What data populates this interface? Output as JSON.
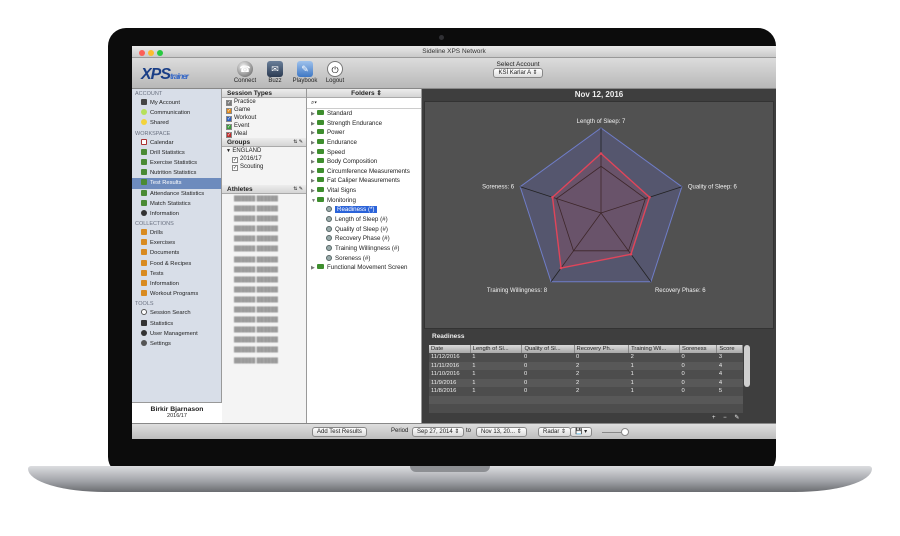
{
  "window": {
    "title": "Sideline XPS Network"
  },
  "logo": {
    "main": "XPS",
    "sub": "trainer"
  },
  "toolbar": [
    {
      "label": "Connect",
      "icon": "connect-icon"
    },
    {
      "label": "Buzz",
      "icon": "buzz-icon"
    },
    {
      "label": "Playbook",
      "icon": "playbook-icon"
    },
    {
      "label": "Logout",
      "icon": "logout-icon"
    }
  ],
  "account": {
    "label": "Select Account",
    "value": "KSÍ Karlar A"
  },
  "sidebar": {
    "account_header": "ACCOUNT",
    "account": [
      "My Account",
      "Communication",
      "Shared"
    ],
    "workspace_header": "WORKSPACE",
    "workspace": [
      "Calendar",
      "Drill Statistics",
      "Exercise Statistics",
      "Nutrition Statistics",
      "Test Results",
      "Attendance Statistics",
      "Match Statistics",
      "Information"
    ],
    "collections_header": "COLLECTIONS",
    "collections": [
      "Drills",
      "Exercises",
      "Documents",
      "Food & Recipes",
      "Tests",
      "Information",
      "Workout Programs"
    ],
    "tools_header": "TOOLS",
    "tools": [
      "Session Search",
      "Statistics",
      "User Management",
      "Settings"
    ]
  },
  "profile": {
    "name": "Birkir Bjarnason",
    "season": "2016/17"
  },
  "session_types": {
    "header": "Session Types",
    "items": [
      {
        "label": "Practice",
        "color": "#7a7a7a"
      },
      {
        "label": "Game",
        "color": "#e28a1b"
      },
      {
        "label": "Workout",
        "color": "#2c5fc0"
      },
      {
        "label": "Event",
        "color": "#3a9a3a"
      },
      {
        "label": "Meal",
        "color": "#c02b2b"
      }
    ]
  },
  "groups": {
    "header": "Groups",
    "items": [
      "ENGLAND",
      "2016/17",
      "Scouting"
    ]
  },
  "athletes": {
    "header": "Athletes"
  },
  "folders": {
    "label": "Folders",
    "search_placeholder": "",
    "items": [
      "Standard",
      "Strength Endurance",
      "Power",
      "Endurance",
      "Speed",
      "Body Composition",
      "Circumference Measurements",
      "Fat Caliper Measurements",
      "Vital Signs",
      "Monitoring"
    ],
    "monitoring": [
      "Readiness (*)",
      "Length of Sleep (#)",
      "Quality of Sleep (#)",
      "Recovery Phase (#)",
      "Training Willingness (#)",
      "Soreness (#)"
    ],
    "last": "Functional Movement Screen"
  },
  "chart_data": {
    "type": "radar",
    "title": "Nov 12, 2016",
    "axes": [
      "Length of Sleep: 7",
      "Quality of Sleep: 6",
      "Recovery Phase: 6",
      "Training Willingness: 8",
      "Soreness: 6"
    ],
    "values": [
      7,
      6,
      6,
      8,
      6
    ],
    "max": 10,
    "color": "#e0455a",
    "grid_color": "#222222"
  },
  "readiness": {
    "title": "Readiness",
    "columns": [
      "Date",
      "Length of Sl...",
      "Quality of Sl...",
      "Recovery Ph...",
      "Training Wil...",
      "Soreness",
      "Score"
    ],
    "rows": [
      [
        "11/12/2016",
        "1",
        "0",
        "0",
        "2",
        "0",
        "3"
      ],
      [
        "11/11/2016",
        "1",
        "0",
        "2",
        "1",
        "0",
        "4"
      ],
      [
        "11/10/2016",
        "1",
        "0",
        "2",
        "1",
        "0",
        "4"
      ],
      [
        "11/9/2016",
        "1",
        "0",
        "2",
        "1",
        "0",
        "4"
      ],
      [
        "11/8/2016",
        "1",
        "0",
        "2",
        "1",
        "0",
        "5"
      ],
      [
        "",
        "",
        "",
        "",
        "",
        "",
        ""
      ],
      [
        "",
        "",
        "",
        "",
        "",
        "",
        ""
      ]
    ]
  },
  "status": {
    "add_label": "Add Test Results",
    "period_label": "Period",
    "from": "Sep 27, 2014",
    "to_label": "to",
    "to": "Nov 13, 20...",
    "chart_type": "Radar"
  }
}
